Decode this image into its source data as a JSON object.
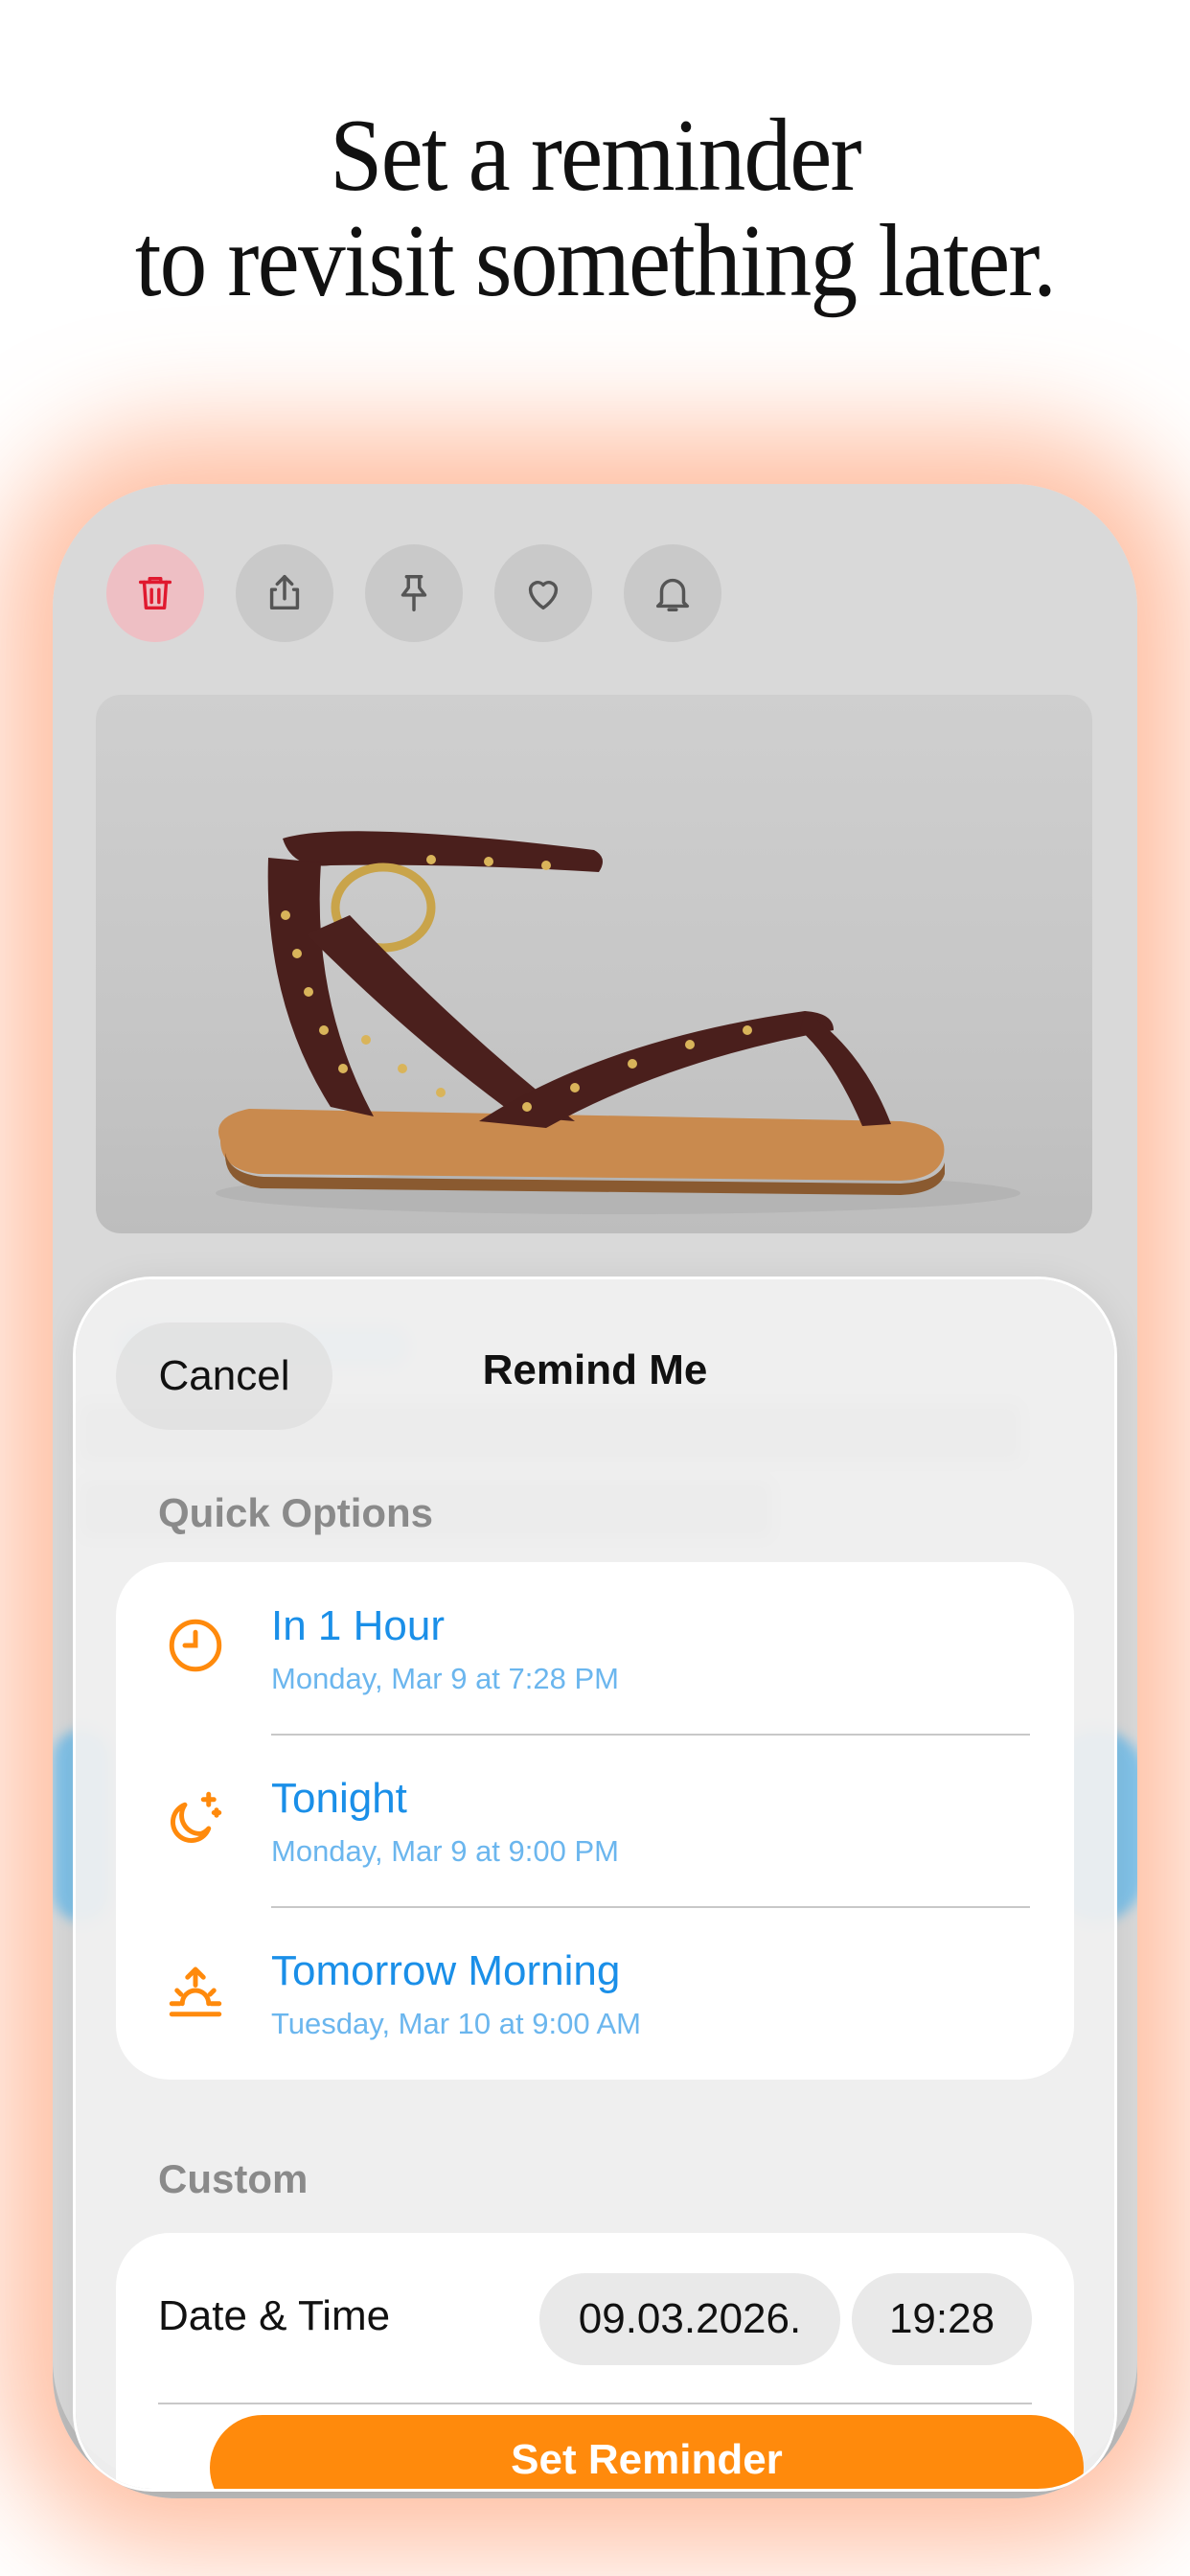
{
  "headline": {
    "line1": "Set a reminder",
    "line2": "to revisit something later."
  },
  "toolbar": {
    "buttons": [
      {
        "icon": "trash-icon",
        "color": "#e0192f"
      },
      {
        "icon": "share-icon",
        "color": "#555555"
      },
      {
        "icon": "pin-icon",
        "color": "#555555"
      },
      {
        "icon": "heart-icon",
        "color": "#555555"
      },
      {
        "icon": "bell-icon",
        "color": "#555555"
      }
    ]
  },
  "sheet": {
    "cancel_label": "Cancel",
    "title": "Remind Me",
    "quick_options_label": "Quick Options",
    "quick_options": [
      {
        "title": "In 1 Hour",
        "subtitle": "Monday, Mar 9 at 7:28 PM",
        "icon": "clock-icon"
      },
      {
        "title": "Tonight",
        "subtitle": "Monday, Mar 9 at 9:00 PM",
        "icon": "moon-stars-icon"
      },
      {
        "title": "Tomorrow Morning",
        "subtitle": "Tuesday, Mar 10 at 9:00 AM",
        "icon": "sunrise-icon"
      }
    ],
    "custom_label": "Custom",
    "date_time_label": "Date & Time",
    "date_value": "09.03.2026.",
    "time_value": "19:28",
    "set_button_label": "Set Reminder"
  },
  "colors": {
    "accent_orange": "#ff8a0c",
    "option_blue": "#1a8fe8",
    "glow": "#ff9a6a"
  }
}
